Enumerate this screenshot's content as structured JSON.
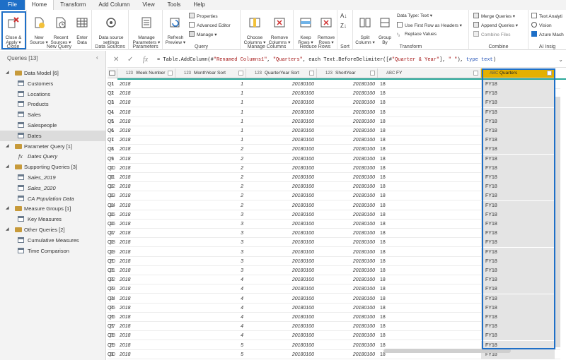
{
  "tabs": [
    "File",
    "Home",
    "Transform",
    "Add Column",
    "View",
    "Tools",
    "Help"
  ],
  "ribbon": {
    "close_group": {
      "label": "Close",
      "close_apply": "Close &\nApply ▾"
    },
    "new_query_group": {
      "label": "New Query",
      "new_source": "New\nSource ▾",
      "recent_sources": "Recent\nSources ▾",
      "enter_data": "Enter\nData"
    },
    "data_sources_group": {
      "label": "Data Sources",
      "settings": "Data source\nsettings"
    },
    "parameters_group": {
      "label": "Parameters",
      "manage": "Manage\nParameters ▾"
    },
    "query_group": {
      "label": "Query",
      "refresh": "Refresh\nPreview ▾",
      "properties": "Properties",
      "advanced_editor": "Advanced Editor",
      "manage": "Manage ▾"
    },
    "manage_columns_group": {
      "label": "Manage Columns",
      "choose": "Choose\nColumns ▾",
      "remove": "Remove\nColumns ▾"
    },
    "reduce_rows_group": {
      "label": "Reduce Rows",
      "keep": "Keep\nRows ▾",
      "remove": "Remove\nRows ▾"
    },
    "sort_group": {
      "label": "Sort"
    },
    "transform_group": {
      "label": "Transform",
      "split": "Split\nColumn ▾",
      "group_by": "Group\nBy",
      "data_type": "Data Type: Text ▾",
      "first_row": "Use First Row as Headers ▾",
      "replace": "Replace Values"
    },
    "combine_group": {
      "label": "Combine",
      "merge": "Merge Queries ▾",
      "append": "Append Queries ▾",
      "combine_files": "Combine Files"
    },
    "ai_group": {
      "label": "AI Insig",
      "text": "Text Analyti",
      "vision": "Vision",
      "azure": "Azure Mach"
    }
  },
  "queries_panel": {
    "header": "Queries [13]",
    "items": [
      {
        "label": "Data Model [6]",
        "kind": "folder"
      },
      {
        "label": "Customers",
        "kind": "table"
      },
      {
        "label": "Locations",
        "kind": "table"
      },
      {
        "label": "Products",
        "kind": "table"
      },
      {
        "label": "Sales",
        "kind": "table"
      },
      {
        "label": "Salespeople",
        "kind": "table"
      },
      {
        "label": "Dates",
        "kind": "table",
        "selected": true
      },
      {
        "label": "Parameter Query [1]",
        "kind": "folder"
      },
      {
        "label": "Dates Query",
        "kind": "fx"
      },
      {
        "label": "Supporting Queries [3]",
        "kind": "folder"
      },
      {
        "label": "Sales_2019",
        "kind": "table"
      },
      {
        "label": "Sales_2020",
        "kind": "table"
      },
      {
        "label": "CA Population Data",
        "kind": "table"
      },
      {
        "label": "Measure Groups [1]",
        "kind": "folder"
      },
      {
        "label": "Key Measures",
        "kind": "table"
      },
      {
        "label": "Other Queries [2]",
        "kind": "folder"
      },
      {
        "label": "Cumulative Measures",
        "kind": "table"
      },
      {
        "label": "Time Comparison",
        "kind": "table"
      }
    ]
  },
  "formula_bar": {
    "fx": "fx",
    "prefix": "= Table.AddColumn(#",
    "s1": "\"Renamed Columns1\"",
    "mid1": ", ",
    "s2": "\"Quarters\"",
    "mid2": ", each Text.BeforeDelimiter([#",
    "s3": "\"Quarter & Year\"",
    "mid3": "], ",
    "s4": "\" \"",
    "mid4": "), ",
    "kw": "type text",
    "suffix": ")"
  },
  "grid": {
    "columns": [
      {
        "type": "",
        "name": ""
      },
      {
        "type": "123",
        "name": "Week Number"
      },
      {
        "type": "123",
        "name": "MonthYear Sort"
      },
      {
        "type": "123",
        "name": "QuarterYear Sort"
      },
      {
        "type": "123",
        "name": "ShortYear"
      },
      {
        "type": "ABC",
        "name": "FY"
      },
      {
        "type": "ABC",
        "name": "Quarters"
      }
    ],
    "rows": [
      [
        "2018",
        "1",
        "20180100",
        "20180100",
        "18",
        "FY18",
        "Q1"
      ],
      [
        "2018",
        "1",
        "20180100",
        "20180100",
        "18",
        "FY18",
        "Q1"
      ],
      [
        "2018",
        "1",
        "20180100",
        "20180100",
        "18",
        "FY18",
        "Q1"
      ],
      [
        "2018",
        "1",
        "20180100",
        "20180100",
        "18",
        "FY18",
        "Q1"
      ],
      [
        "2018",
        "1",
        "20180100",
        "20180100",
        "18",
        "FY18",
        "Q1"
      ],
      [
        "2018",
        "1",
        "20180100",
        "20180100",
        "18",
        "FY18",
        "Q1"
      ],
      [
        "2018",
        "1",
        "20180100",
        "20180100",
        "18",
        "FY18",
        "Q1"
      ],
      [
        "2018",
        "2",
        "20180100",
        "20180100",
        "18",
        "FY18",
        "Q1"
      ],
      [
        "2018",
        "2",
        "20180100",
        "20180100",
        "18",
        "FY18",
        "Q1"
      ],
      [
        "2018",
        "2",
        "20180100",
        "20180100",
        "18",
        "FY18",
        "Q1"
      ],
      [
        "2018",
        "2",
        "20180100",
        "20180100",
        "18",
        "FY18",
        "Q1"
      ],
      [
        "2018",
        "2",
        "20180100",
        "20180100",
        "18",
        "FY18",
        "Q1"
      ],
      [
        "2018",
        "2",
        "20180100",
        "20180100",
        "18",
        "FY18",
        "Q1"
      ],
      [
        "2018",
        "2",
        "20180100",
        "20180100",
        "18",
        "FY18",
        "Q1"
      ],
      [
        "2018",
        "3",
        "20180100",
        "20180100",
        "18",
        "FY18",
        "Q1"
      ],
      [
        "2018",
        "3",
        "20180100",
        "20180100",
        "18",
        "FY18",
        "Q1"
      ],
      [
        "2018",
        "3",
        "20180100",
        "20180100",
        "18",
        "FY18",
        "Q1"
      ],
      [
        "2018",
        "3",
        "20180100",
        "20180100",
        "18",
        "FY18",
        "Q1"
      ],
      [
        "2018",
        "3",
        "20180100",
        "20180100",
        "18",
        "FY18",
        "Q1"
      ],
      [
        "2018",
        "3",
        "20180100",
        "20180100",
        "18",
        "FY18",
        "Q1"
      ],
      [
        "2018",
        "3",
        "20180100",
        "20180100",
        "18",
        "FY18",
        "Q1"
      ],
      [
        "2018",
        "4",
        "20180100",
        "20180100",
        "18",
        "FY18",
        "Q1"
      ],
      [
        "2018",
        "4",
        "20180100",
        "20180100",
        "18",
        "FY18",
        "Q1"
      ],
      [
        "2018",
        "4",
        "20180100",
        "20180100",
        "18",
        "FY18",
        "Q1"
      ],
      [
        "2018",
        "4",
        "20180100",
        "20180100",
        "18",
        "FY18",
        "Q1"
      ],
      [
        "2018",
        "4",
        "20180100",
        "20180100",
        "18",
        "FY18",
        "Q1"
      ],
      [
        "2018",
        "4",
        "20180100",
        "20180100",
        "18",
        "FY18",
        "Q1"
      ],
      [
        "2018",
        "4",
        "20180100",
        "20180100",
        "18",
        "FY18",
        "Q1"
      ],
      [
        "2018",
        "5",
        "20180100",
        "20180100",
        "18",
        "FY18",
        "Q1"
      ],
      [
        "2018",
        "5",
        "20180100",
        "20180100",
        "18",
        "FY18",
        "Q1"
      ]
    ]
  },
  "colors": {
    "accent": "#1e6fc7",
    "highlight_header": "#e3b000",
    "teal_line": "#2aa89a",
    "folder": "#c79a3a"
  }
}
